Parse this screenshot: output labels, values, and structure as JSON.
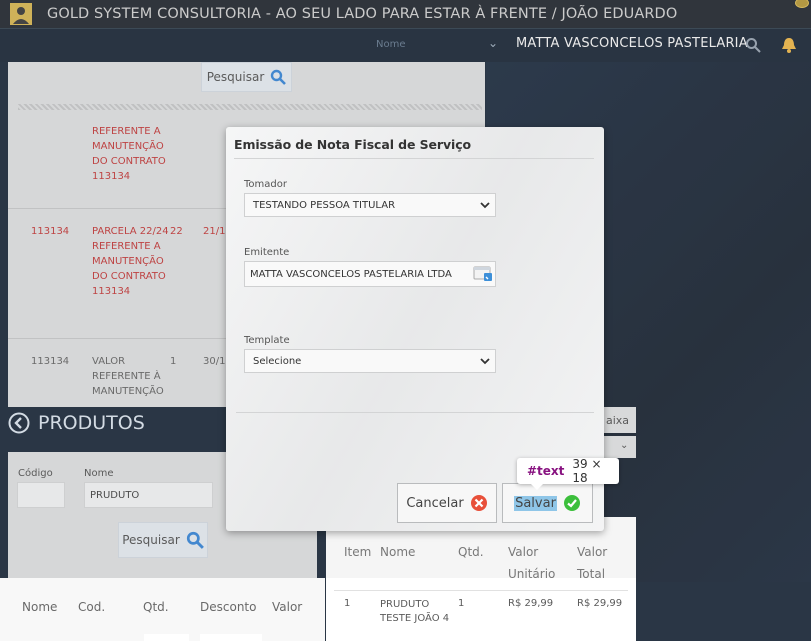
{
  "topbar": {
    "title": "GOLD SYSTEM CONSULTORIA - AO SEU LADO PARA ESTAR À FRENTE / JOÃO EDUARDO"
  },
  "search": {
    "field_label": "Nome",
    "client_name": "MATTA VASCONCELOS PASTELARIA LTD"
  },
  "top_panel": {
    "search_button": "Pesquisar",
    "rows": [
      {
        "col1": "",
        "col2": "REFERENTE A MANUTENÇÃO DO CONTRATO 113134",
        "col3": "",
        "col4": ""
      },
      {
        "col1": "113134",
        "col2": "PARCELA 22/24 REFERENTE A MANUTENÇÃO DO CONTRATO 113134",
        "col3": "22",
        "col4": "21/1"
      },
      {
        "col1": "113134",
        "col2": "VALOR REFERENTE À MANUTENÇÃO",
        "col3": "1",
        "col4": "30/1"
      }
    ]
  },
  "produtos": {
    "heading": "PRODUTOS",
    "codigo_label": "Código",
    "nome_label": "Nome",
    "codigo_value": "",
    "nome_value": "PRUDUTO",
    "search_button": "Pesquisar",
    "columns": [
      "Nome",
      "Cod.",
      "Qtd.",
      "Desconto",
      "Valor"
    ]
  },
  "items_table": {
    "columns": [
      "Item",
      "Nome",
      "Qtd.",
      "Valor Unitário",
      "Valor Total"
    ],
    "rows": [
      {
        "item": "1",
        "nome": "PRUDUTO TESTE JOÃO 4",
        "qtd": "1",
        "unitario": "R$ 29,99",
        "total": "R$ 29,99"
      }
    ]
  },
  "right_controls": {
    "baixa_label": "aixa"
  },
  "modal": {
    "title": "Emissão de Nota Fiscal de Serviço",
    "tomador_label": "Tomador",
    "tomador_value": "TESTANDO PESSOA TITULAR",
    "emitente_label": "Emitente",
    "emitente_value": "MATTA VASCONCELOS PASTELARIA LTDA",
    "template_label": "Template",
    "template_value": "Selecione",
    "cancel_button": "Cancelar",
    "save_button": "Salvar"
  },
  "devtools_tooltip": {
    "tag": "#text",
    "size": "39 × 18"
  },
  "colors": {
    "topbar": "#141a21",
    "background": "#0d1b2c",
    "panel": "#d1d2d3",
    "red_text": "#b52a2a",
    "cancel_icon": "#e8503a",
    "save_icon": "#3cbf3c",
    "search_icon": "#2a78c9"
  }
}
